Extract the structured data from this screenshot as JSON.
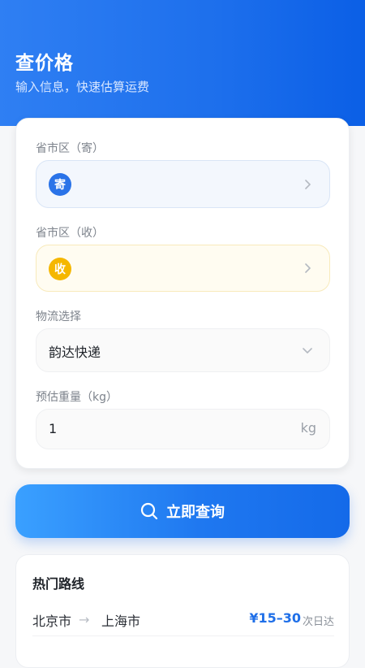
{
  "header": {
    "title": "查价格",
    "subtitle": "输入信息，快速估算运费"
  },
  "form": {
    "sender_label": "省市区（寄）",
    "sender_badge": "寄",
    "sender_value": "",
    "receiver_label": "省市区（收）",
    "receiver_badge": "收",
    "receiver_value": "",
    "logistics_label": "物流选择",
    "logistics_value": "韵达快递",
    "weight_label": "预估重量（kg）",
    "weight_value": "1",
    "weight_unit": "kg"
  },
  "query_button": {
    "label": "立即查询",
    "icon": "search-icon"
  },
  "hot_routes": {
    "title": "热门路线",
    "routes": [
      {
        "from": "北京市",
        "arrow": "→",
        "to": "上海市",
        "price": "¥15–30",
        "eta": "次日达"
      }
    ]
  },
  "colors": {
    "primary": "#1d6fec",
    "sender_badge": "#2a73e8",
    "receiver_badge": "#f5b700"
  }
}
